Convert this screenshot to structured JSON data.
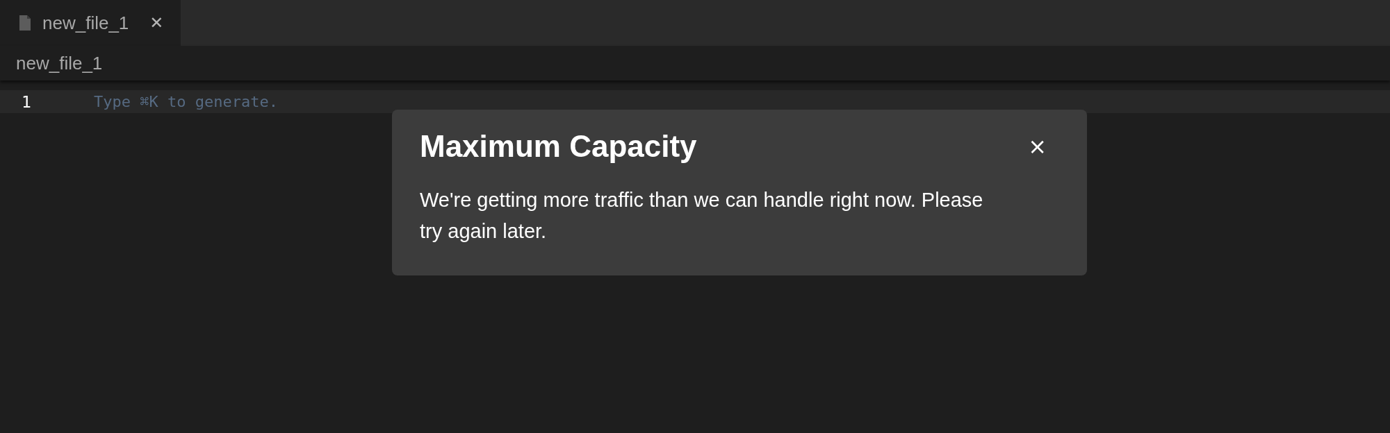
{
  "tabs": [
    {
      "label": "new_file_1",
      "selected": true,
      "close": "✕"
    }
  ],
  "breadcrumb": "new_file_1",
  "editor": {
    "lines": [
      {
        "number": "1",
        "placeholder": "Type ⌘K to generate.",
        "current": true
      }
    ]
  },
  "dialog": {
    "title": "Maximum Capacity",
    "message": "We're getting more traffic than we can handle right now. Please try again later.",
    "close": "×"
  }
}
